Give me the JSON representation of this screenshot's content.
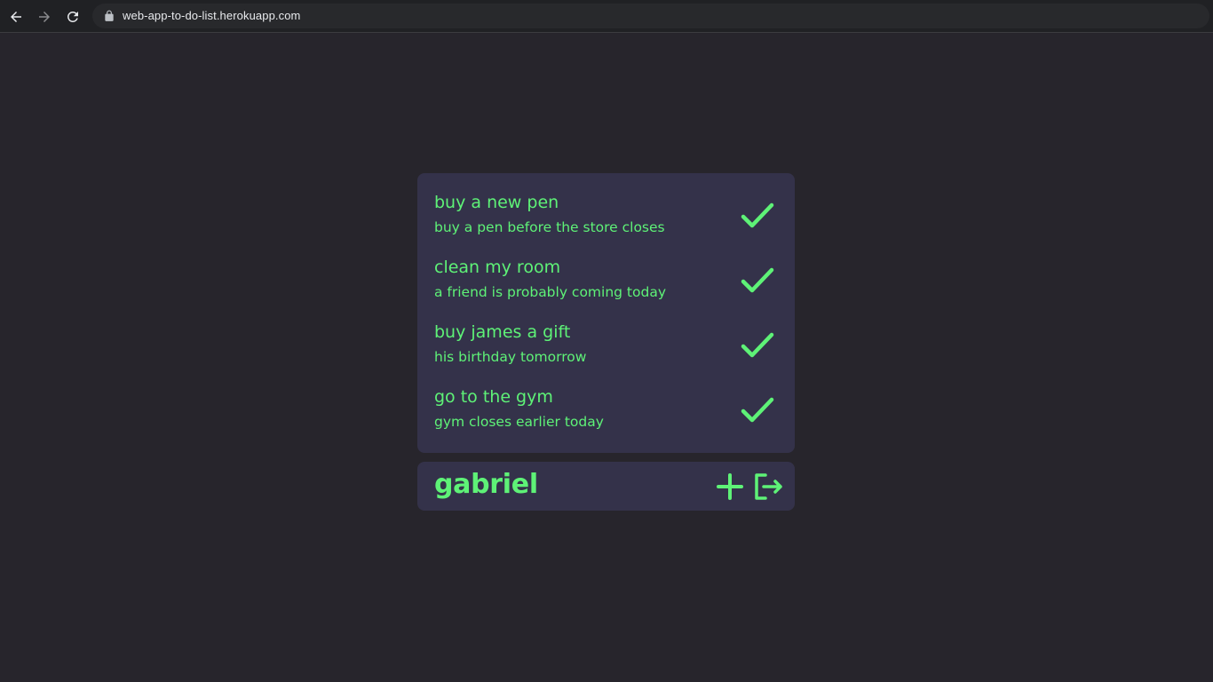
{
  "browser": {
    "url": "web-app-to-do-list.herokuapp.com",
    "back_icon": "arrow-left-icon",
    "forward_icon": "arrow-right-icon",
    "reload_icon": "reload-icon",
    "lock_icon": "lock-icon"
  },
  "tasks": [
    {
      "title": "buy a new pen",
      "description": "buy a pen before the store closes"
    },
    {
      "title": "clean my room",
      "description": "a friend is probably coming today"
    },
    {
      "title": "buy james a gift",
      "description": "his birthday tomorrow"
    },
    {
      "title": "go to the gym",
      "description": "gym closes earlier today"
    }
  ],
  "footer": {
    "username": "gabriel",
    "add_icon": "plus-icon",
    "logout_icon": "logout-icon"
  },
  "colors": {
    "background": "#27252c",
    "card": "#34324a",
    "accent": "#5ef277",
    "chrome": "#202124"
  }
}
